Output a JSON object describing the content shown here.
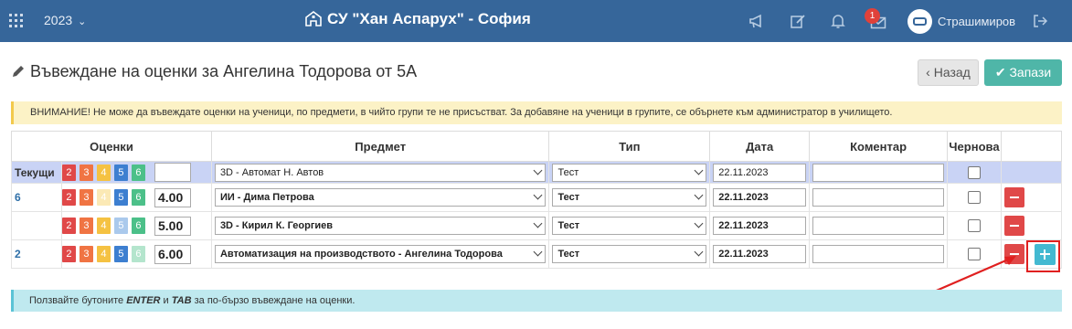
{
  "topbar": {
    "year": "2023",
    "school_title": "СУ \"Хан Аспарух\" - София",
    "notifications_count": "1",
    "username": "Страшимиров",
    "icons": [
      "apps-grid-icon",
      "chevron-down-icon",
      "school-icon",
      "megaphone-icon",
      "edit-icon",
      "bell-icon",
      "mail-icon",
      "user-avatar-icon",
      "logout-icon"
    ]
  },
  "page": {
    "title": "Въвеждане на оценки за Ангелина Тодорова от 5А",
    "back_label": "Назад",
    "save_label": "Запази"
  },
  "warning": "ВНИМАНИЕ! Не може да въвеждате оценки на ученици, по предмети, в чийто групи те не присъстват. За добавяне на ученици в групите, се обърнете към администратор в училището.",
  "table": {
    "headers": {
      "grades": "Оценки",
      "subject": "Предмет",
      "type": "Тип",
      "date": "Дата",
      "comment": "Коментар",
      "draft": "Чернова"
    },
    "grade_buttons": [
      "2",
      "3",
      "4",
      "5",
      "6"
    ],
    "rows": [
      {
        "label": "Текущи",
        "grade_value": "",
        "subject": "3D - Автомат Н. Автов",
        "type": "Тест",
        "date": "22.11.2023",
        "comment": ""
      },
      {
        "label": "6",
        "grade_value": "4.00",
        "subject": "ИИ - Дима Петрова",
        "type": "Тест",
        "date": "22.11.2023",
        "comment": ""
      },
      {
        "label": "",
        "grade_value": "5.00",
        "subject": "3D - Кирил К. Георгиев",
        "type": "Тест",
        "date": "22.11.2023",
        "comment": ""
      },
      {
        "label": "2",
        "grade_value": "6.00",
        "subject": "Автоматизация на производството - Ангелина Тодорова",
        "type": "Тест",
        "date": "22.11.2023",
        "comment": ""
      }
    ]
  },
  "info": {
    "prefix": "Ползвайте бутоните ",
    "key1": "ENTER",
    "middle": " и ",
    "key2": "TAB",
    "suffix": " за по-бързо въвеждане на оценки."
  },
  "colors": {
    "topbar": "#36669a",
    "save": "#4fb6a8",
    "delete": "#e04848",
    "add": "#43b9d1",
    "highlight": "#e02020"
  }
}
